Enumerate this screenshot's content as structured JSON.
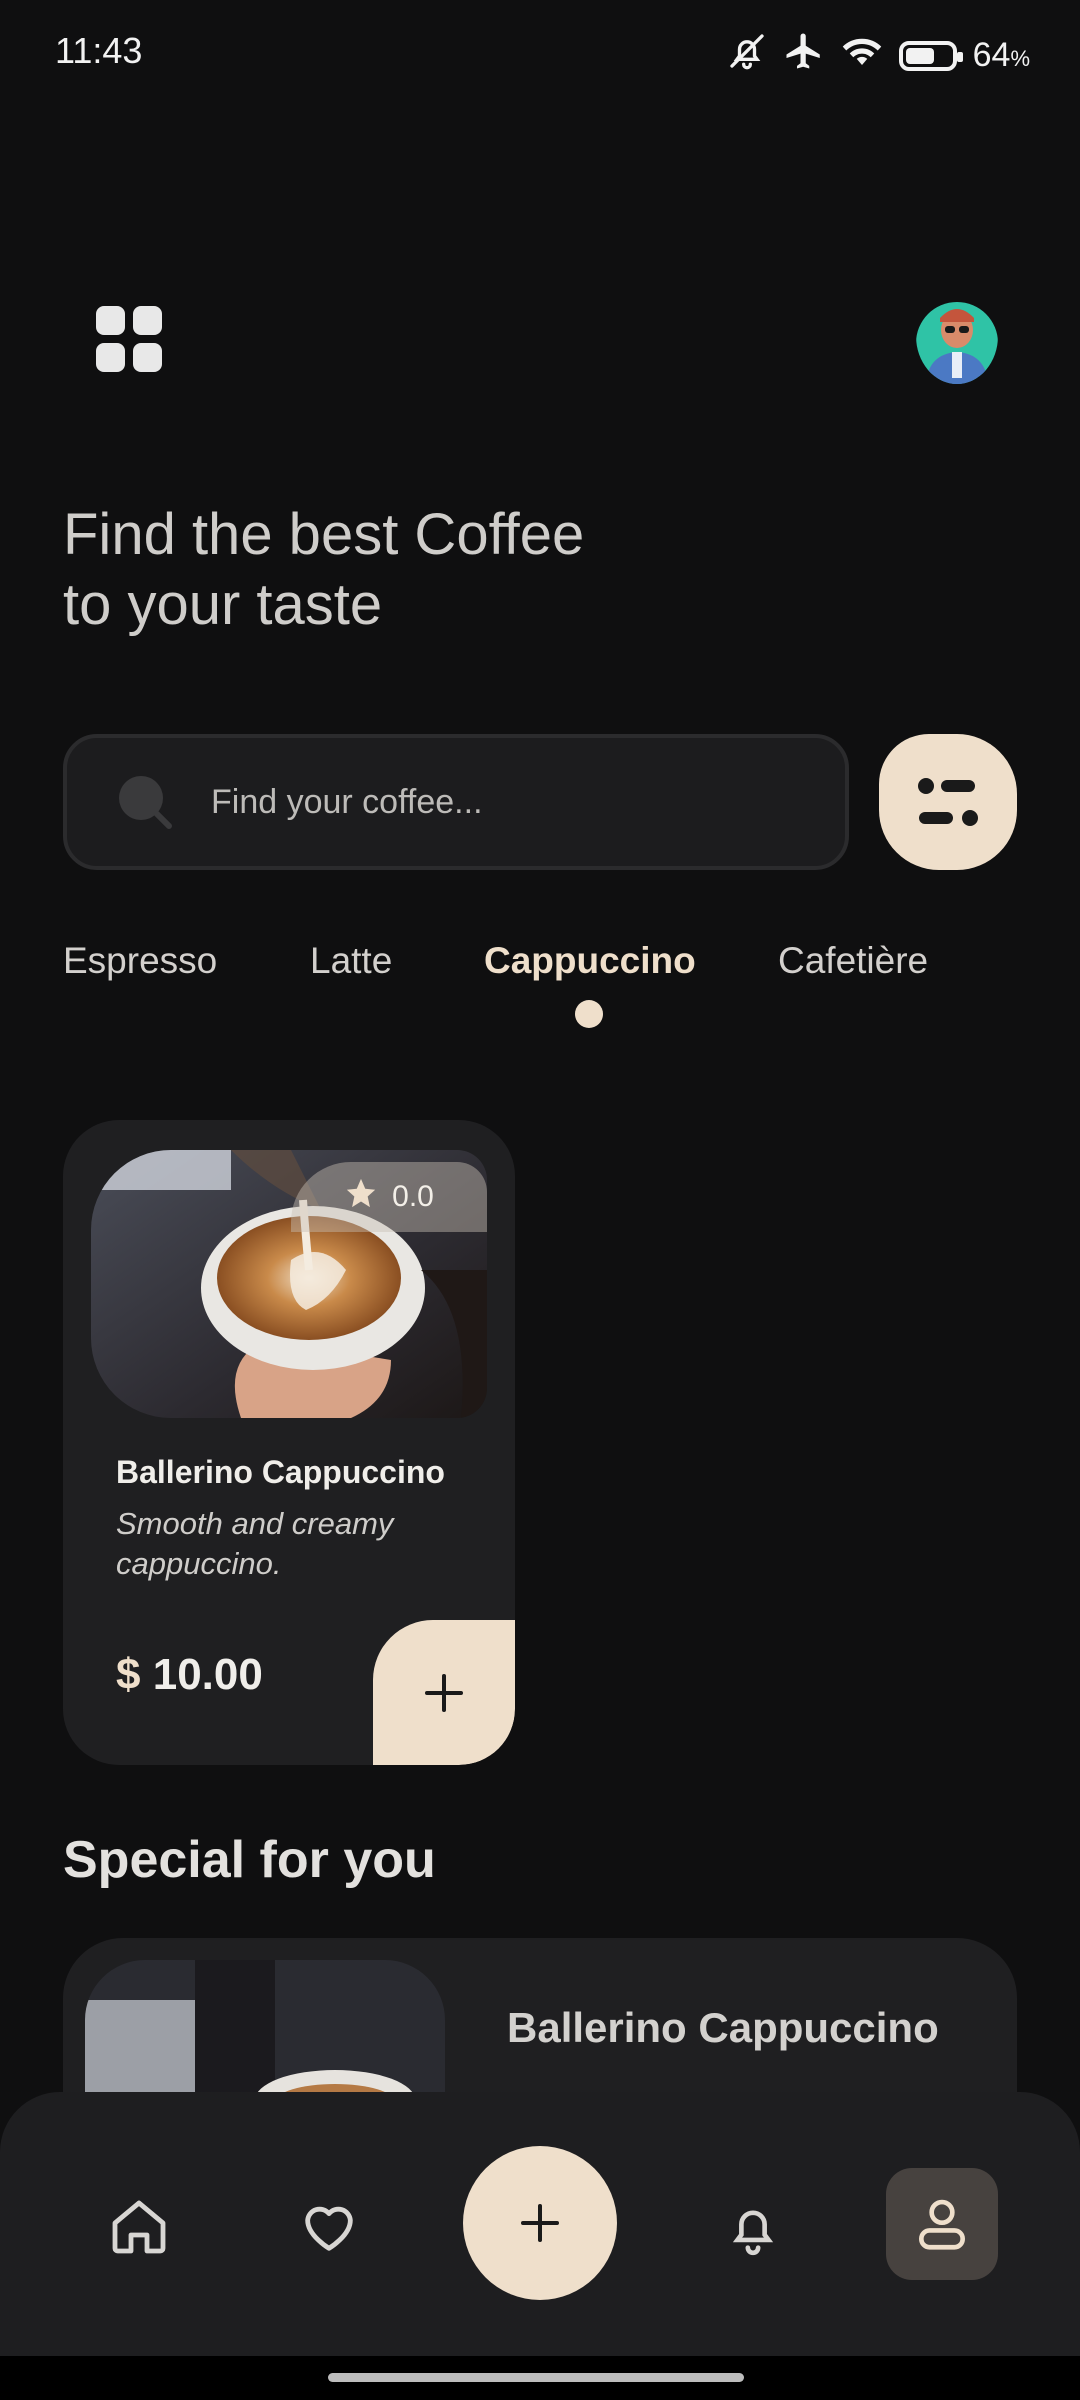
{
  "status_bar": {
    "time": "11:43",
    "battery_percent": "64",
    "battery_unit": "%",
    "battery_level": 0.64,
    "icons": [
      "bell-off-icon",
      "airplane-icon",
      "wifi-icon",
      "battery-icon"
    ]
  },
  "header": {
    "menu_icon": "grid-icon",
    "avatar": "avatar"
  },
  "headline": {
    "line1": "Find the best Coffee",
    "line2": "to your taste"
  },
  "search": {
    "placeholder": "Find your coffee...",
    "icon": "search-icon",
    "filter_icon": "filter-icon"
  },
  "tabs": [
    {
      "label": "Espresso",
      "active": false
    },
    {
      "label": "Latte",
      "active": false
    },
    {
      "label": "Cappuccino",
      "active": true
    },
    {
      "label": "Cafetière",
      "active": false
    }
  ],
  "product_card": {
    "rating": "0.0",
    "title": "Ballerino Cappuccino",
    "description": "Smooth and creamy cappuccino.",
    "currency": "$",
    "price": "10.00",
    "add_icon": "plus-icon"
  },
  "special": {
    "section_title": "Special for you",
    "item_title": "Ballerino Cappuccino"
  },
  "bottom_nav": {
    "items": [
      "home-icon",
      "heart-icon",
      "plus-icon",
      "bell-icon",
      "profile-icon"
    ],
    "active": "profile-icon"
  },
  "colors": {
    "background": "#0f0f10",
    "accent": "#efdfcb",
    "card": "#1f1f21"
  }
}
